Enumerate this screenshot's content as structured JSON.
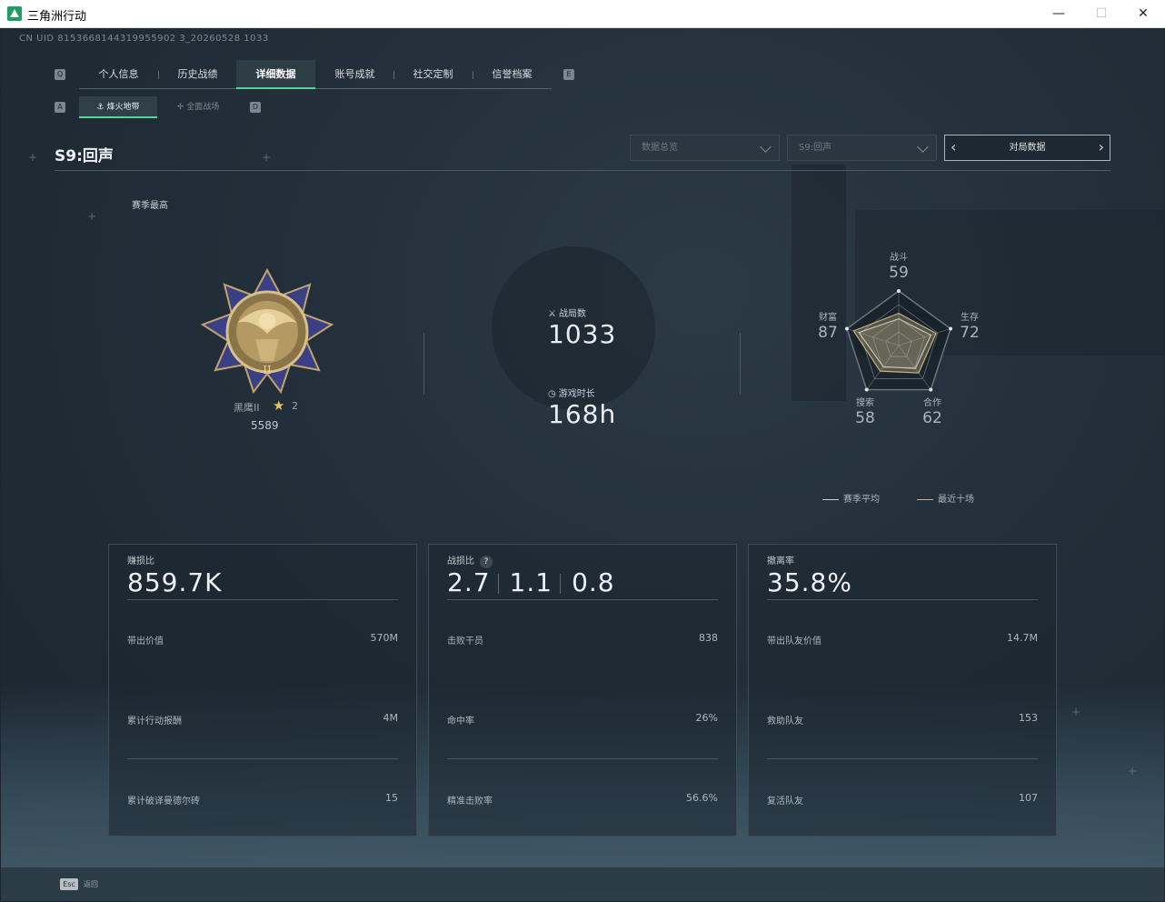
{
  "window": {
    "title": "三角洲行动",
    "min_glyph": "—",
    "max_glyph": "☐",
    "close_glyph": "✕"
  },
  "uid": "CN UID 8153668144319955902 3_20260528 1033",
  "nav": {
    "left_key": "Q",
    "right_key": "E",
    "tabs": [
      "个人信息",
      "历史战绩",
      "详细数据",
      "账号成就",
      "社交定制",
      "信誉档案"
    ],
    "active_tab": "详细数据"
  },
  "subnav": {
    "left_key": "A",
    "right_key": "D",
    "tabs": [
      "烽火地带",
      "全面战场"
    ],
    "active_tab": "烽火地带"
  },
  "season_title": "S9:回声",
  "filters": {
    "data_type": "数据总览",
    "season": "S9:回声",
    "match_data_button": "对局数据"
  },
  "season_best_label": "赛季最高",
  "rank": {
    "name": "黑鹰II",
    "stars": "2",
    "score": "5589"
  },
  "stats": {
    "matches_label": "战局数",
    "matches_value": "1033",
    "playtime_label": "游戏时长",
    "playtime_value": "168h"
  },
  "radar": {
    "axes": [
      {
        "label": "战斗",
        "value": "59"
      },
      {
        "label": "生存",
        "value": "72"
      },
      {
        "label": "合作",
        "value": "62"
      },
      {
        "label": "搜索",
        "value": "58"
      },
      {
        "label": "财富",
        "value": "87"
      }
    ],
    "legend_season_avg": "赛季平均",
    "legend_recent": "最近十场",
    "colors": {
      "season_avg": "#c8cfd4",
      "recent": "#c7b27a"
    }
  },
  "panels": [
    {
      "title": "赚损比",
      "main_value": "859.7K",
      "rows": [
        {
          "label": "带出价值",
          "value": "570M"
        },
        {
          "label": "累计行动报酬",
          "value": "4M"
        },
        {
          "label": "累计破译曼德尔砖",
          "value": "15"
        }
      ]
    },
    {
      "title": "战损比",
      "help": "?",
      "values": [
        "2.7",
        "1.1",
        "0.8"
      ],
      "rows": [
        {
          "label": "击败干员",
          "value": "838"
        },
        {
          "label": "命中率",
          "value": "26%"
        },
        {
          "label": "精准击败率",
          "value": "56.6%"
        }
      ]
    },
    {
      "title": "撤离率",
      "main_value": "35.8%",
      "rows": [
        {
          "label": "带出队友价值",
          "value": "14.7M"
        },
        {
          "label": "救助队友",
          "value": "153"
        },
        {
          "label": "复活队友",
          "value": "107"
        }
      ]
    }
  ],
  "footer": {
    "esc_key": "Esc",
    "esc_label": "返回"
  },
  "theme": {
    "accent": "#52d69a"
  }
}
